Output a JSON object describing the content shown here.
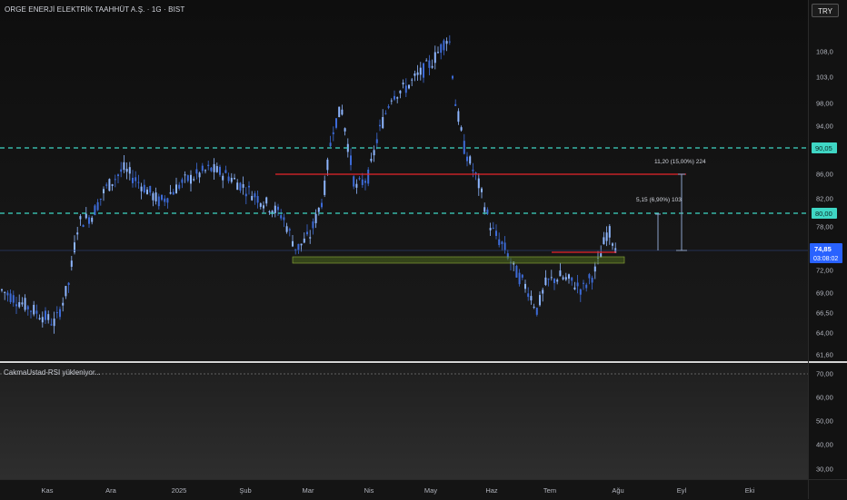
{
  "header": {
    "symbol_title": "ORGE ENERJİ ELEKTRİK TAAHHÜT A.Ş. · 1G · BIST"
  },
  "toolbar": {
    "currency_label": "TRY"
  },
  "rsi": {
    "title": "CakmaUstad-RSI yükleniyor...",
    "ticks": [
      "70,00",
      "60,00",
      "50,00",
      "40,00",
      "30,00"
    ]
  },
  "price_scale": {
    "ticks": [
      "108,0",
      "103,0",
      "98,00",
      "94,00",
      "90,05",
      "86,00",
      "82,00",
      "80,00",
      "78,00",
      "74,85",
      "72,00",
      "69,00",
      "66,50",
      "64,00",
      "61,60"
    ],
    "last_price": "74,85",
    "countdown": "03:08:02",
    "level_upper": "90,05",
    "level_lower": "80,00"
  },
  "annotations": {
    "range_large": "11,20 (15,00%) 224",
    "range_small": "5,15 (6,90%) 103"
  },
  "time_axis": {
    "labels": [
      "Kas",
      "Ara",
      "2025",
      "Şub",
      "Mar",
      "Nis",
      "May",
      "Haz",
      "Tem",
      "Ağu",
      "Eyl",
      "Eki"
    ]
  },
  "colors": {
    "candle": "#3d6bd8",
    "candle_light": "#8eb6ff",
    "support_line": "#3fd6c4",
    "resistance": "#e8242a",
    "zone": "#4f6b1e",
    "last_price_bg": "#2962ff"
  }
}
